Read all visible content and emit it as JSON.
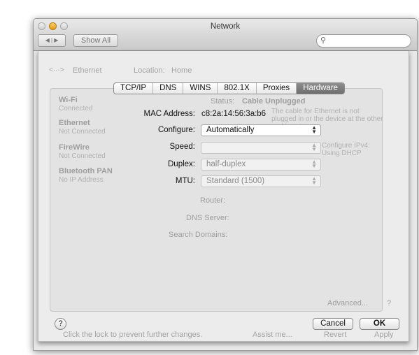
{
  "window": {
    "title": "Network",
    "show_all": "Show All",
    "back": "◀",
    "forward": "▶",
    "search_placeholder": ""
  },
  "background": {
    "service": "Ethernet",
    "location_label": "Location:",
    "location_value": "Home",
    "sidebar": [
      {
        "name": "Wi-Fi",
        "status": "Connected"
      },
      {
        "name": "Ethernet",
        "status": "Not Connected"
      },
      {
        "name": "FireWire",
        "status": "Not Connected"
      },
      {
        "name": "Bluetooth PAN",
        "status": "No IP Address"
      }
    ],
    "status_label": "Status:",
    "status_value": "Cable Unplugged",
    "status_desc": "The cable for Ethernet is not plugged in or the device at the other end is not",
    "configure_ipv4": "Configure IPv4: Using DHCP",
    "router": "Router:",
    "dns_server": "DNS Server:",
    "search_domains": "Search Domains:",
    "advanced": "Advanced...",
    "help": "?",
    "lock_text": "Click the lock to prevent further changes.",
    "assist": "Assist me...",
    "revert": "Revert",
    "apply": "Apply"
  },
  "tabs": [
    "TCP/IP",
    "DNS",
    "WINS",
    "802.1X",
    "Proxies",
    "Hardware"
  ],
  "selected_tab": "Hardware",
  "hardware": {
    "mac_label": "MAC Address:",
    "mac_value": "c8:2a:14:56:3a:b6",
    "configure_label": "Configure:",
    "configure_value": "Automatically",
    "speed_label": "Speed:",
    "speed_value": "",
    "duplex_label": "Duplex:",
    "duplex_value": "half-duplex",
    "mtu_label": "MTU:",
    "mtu_value": "Standard  (1500)"
  },
  "footer": {
    "help": "?",
    "cancel": "Cancel",
    "ok": "OK"
  }
}
